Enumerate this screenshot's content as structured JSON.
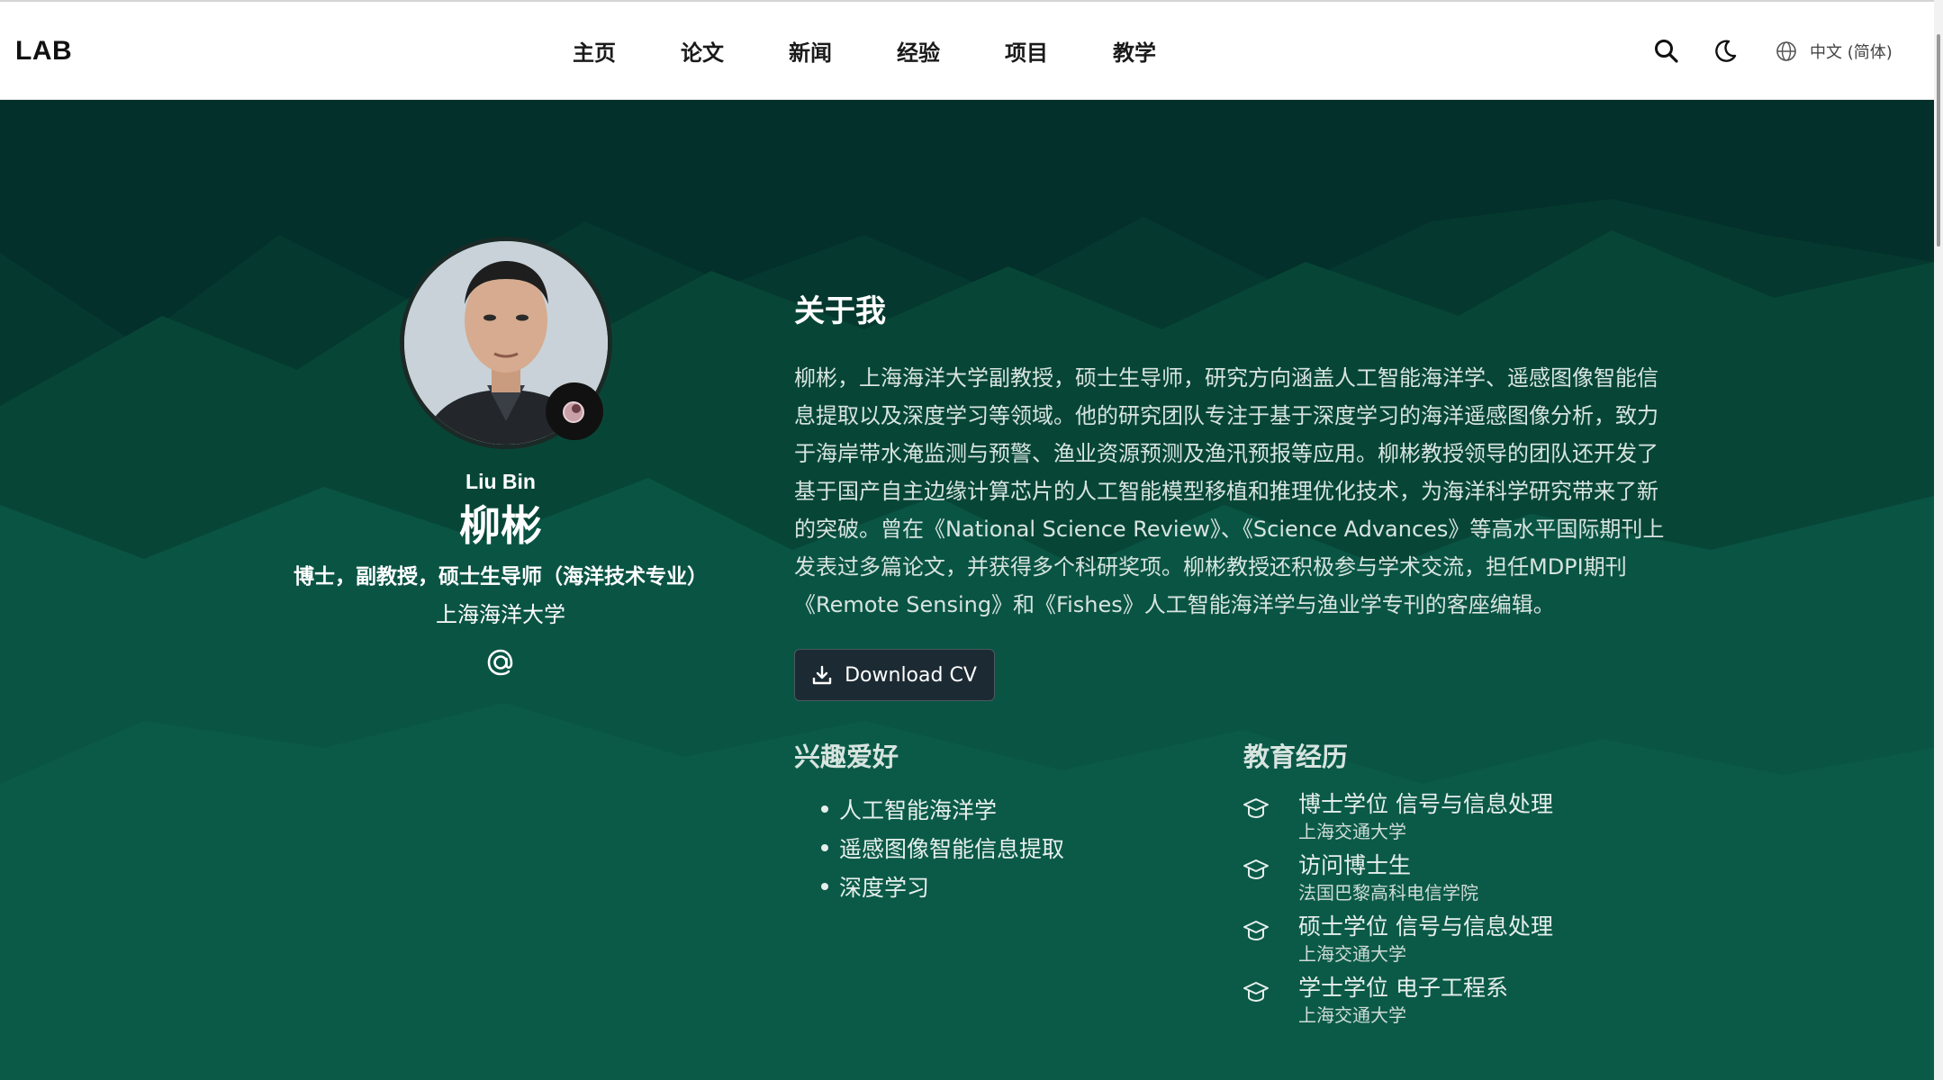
{
  "header": {
    "logo": "LAB",
    "nav": [
      "主页",
      "论文",
      "新闻",
      "经验",
      "项目",
      "教学"
    ],
    "search_icon": "search-icon",
    "theme_icon": "moon-icon",
    "language": "中文 (简体)"
  },
  "profile": {
    "name_en": "Liu Bin",
    "name_cn": "柳彬",
    "role": "博士，副教授，硕士生导师（海洋技术专业）",
    "org": "上海海洋大学",
    "email_icon": "at-icon"
  },
  "about": {
    "title": "关于我",
    "bio": "柳彬，上海海洋大学副教授，硕士生导师，研究方向涵盖人工智能海洋学、遥感图像智能信息提取以及深度学习等领域。他的研究团队专注于基于深度学习的海洋遥感图像分析，致力于海岸带水淹监测与预警、渔业资源预测及渔汛预报等应用。柳彬教授领导的团队还开发了基于国产自主边缘计算芯片的人工智能模型移植和推理优化技术，为海洋科学研究带来了新的突破。曾在《National Science Review》、《Science Advances》等高水平国际期刊上发表过多篇论文，并获得多个科研奖项。柳彬教授还积极参与学术交流，担任MDPI期刊《Remote Sensing》和《Fishes》人工智能海洋学与渔业学专刊的客座编辑。",
    "cv_button": "Download CV"
  },
  "interests": {
    "title": "兴趣爱好",
    "items": [
      "人工智能海洋学",
      "遥感图像智能信息提取",
      "深度学习"
    ]
  },
  "education": {
    "title": "教育经历",
    "items": [
      {
        "degree": "博士学位 信号与信息处理",
        "school": "上海交通大学"
      },
      {
        "degree": "访问博士生",
        "school": "法国巴黎高科电信学院"
      },
      {
        "degree": "硕士学位 信号与信息处理",
        "school": "上海交通大学"
      },
      {
        "degree": "学士学位 电子工程系",
        "school": "上海交通大学"
      }
    ]
  },
  "colors": {
    "bg_dark": "#03302a",
    "bg_mid": "#074637",
    "bg_light": "#0a5a46",
    "button": "#1c2a33"
  }
}
